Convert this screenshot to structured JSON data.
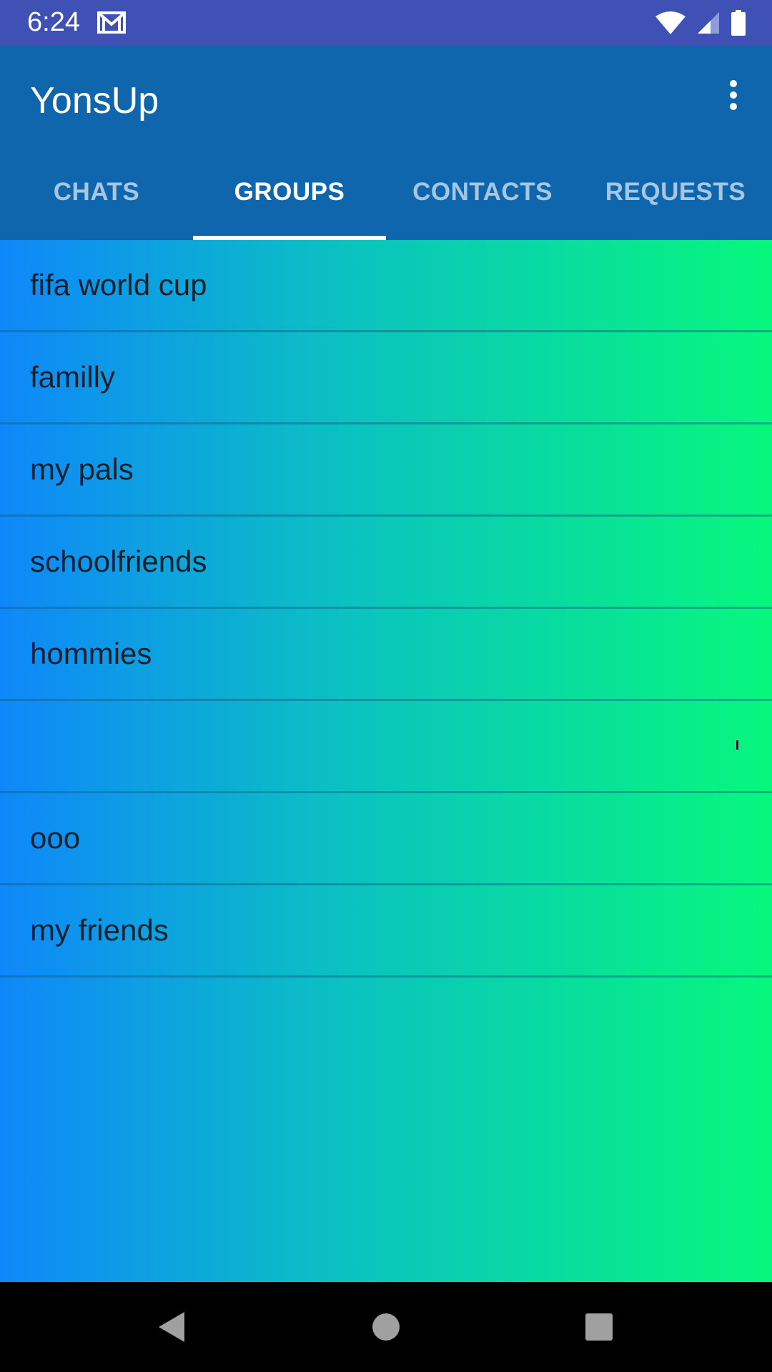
{
  "status_bar": {
    "time": "6:24",
    "icons": [
      "gmail-icon",
      "wifi-icon",
      "cell-signal-icon",
      "battery-icon"
    ]
  },
  "app_bar": {
    "title": "YonsUp",
    "overflow_icon": "more-vert-icon"
  },
  "tabs": [
    {
      "label": "CHATS",
      "active": false
    },
    {
      "label": "GROUPS",
      "active": true
    },
    {
      "label": "CONTACTS",
      "active": false
    },
    {
      "label": "REQUESTS",
      "active": false
    }
  ],
  "groups": [
    {
      "name": "fifa world cup"
    },
    {
      "name": "familly"
    },
    {
      "name": "my pals"
    },
    {
      "name": "schoolfriends"
    },
    {
      "name": "hommies"
    },
    {
      "name": ""
    },
    {
      "name": "ooo"
    },
    {
      "name": "my friends"
    }
  ],
  "nav_bar": {
    "icons": [
      "back-icon",
      "home-icon",
      "recents-icon"
    ]
  },
  "colors": {
    "status_bar": "#3f51b5",
    "app_bar": "#1066ad",
    "gradient_start": "#0f87fa",
    "gradient_end": "#07f77d"
  }
}
